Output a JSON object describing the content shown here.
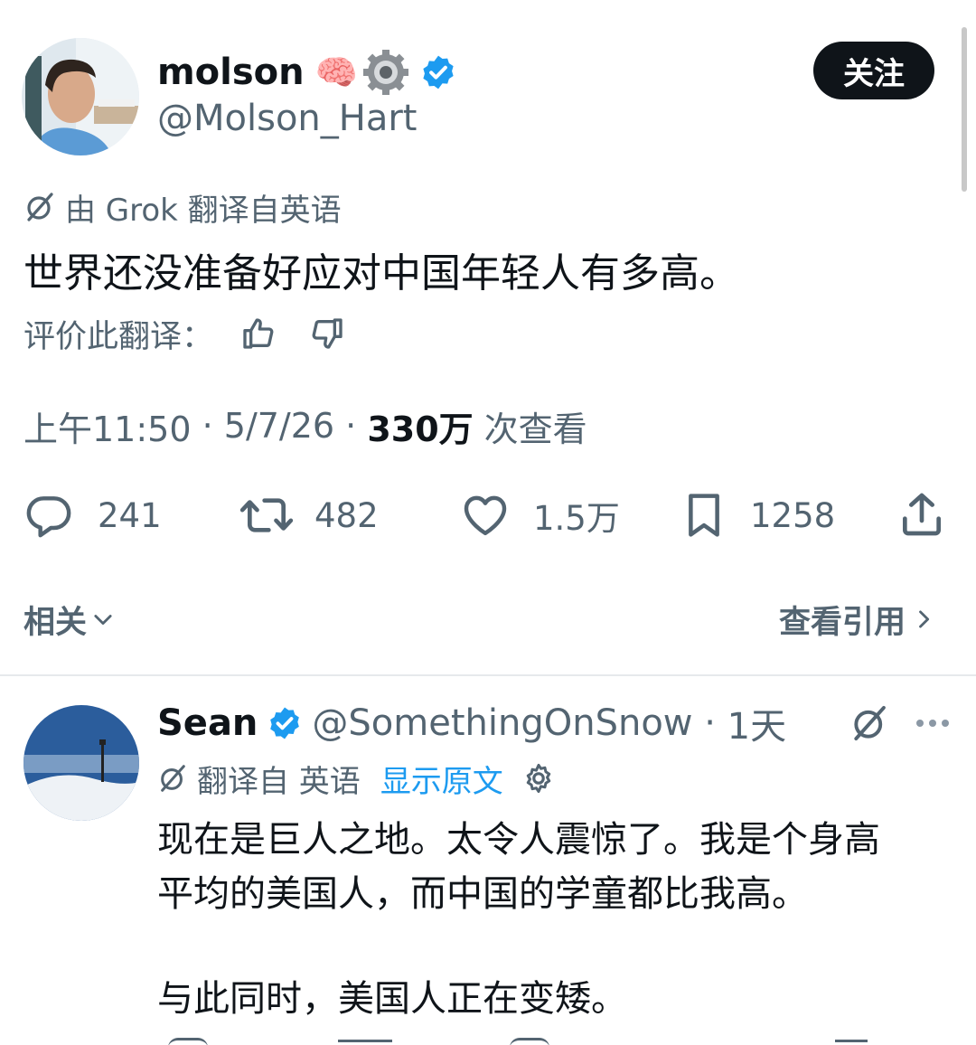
{
  "tweet": {
    "author": {
      "name": "molson",
      "handle": "@Molson_Hart",
      "emoji": "🧠"
    },
    "follow_label": "关注",
    "translation_note": "由 Grok 翻译自英语",
    "text": "世界还没准备好应对中国年轻人有多高。",
    "rate_label": "评价此翻译：",
    "meta": {
      "time": "上午11:50",
      "date": "5/7/26",
      "views_count": "330万",
      "views_label": "次查看"
    },
    "actions": {
      "replies": "241",
      "retweets": "482",
      "likes": "1.5万",
      "bookmarks": "1258"
    },
    "related_label": "相关",
    "quotes_label": "查看引用"
  },
  "reply": {
    "author": {
      "name": "Sean",
      "handle": "@SomethingOnSnow",
      "age": "1天"
    },
    "translation_note": "翻译自 英语",
    "show_original": "显示原文",
    "line1": "现在是巨人之地。太令人震惊了。我是个身高",
    "line2": "平均的美国人，而中国的学童都比我高。",
    "line3": "与此同时，美国人正在变矮。"
  },
  "colors": {
    "verified": "#1d9bf0",
    "text": "#0f1419",
    "muted": "#536471",
    "button_bg": "#0f1419"
  }
}
